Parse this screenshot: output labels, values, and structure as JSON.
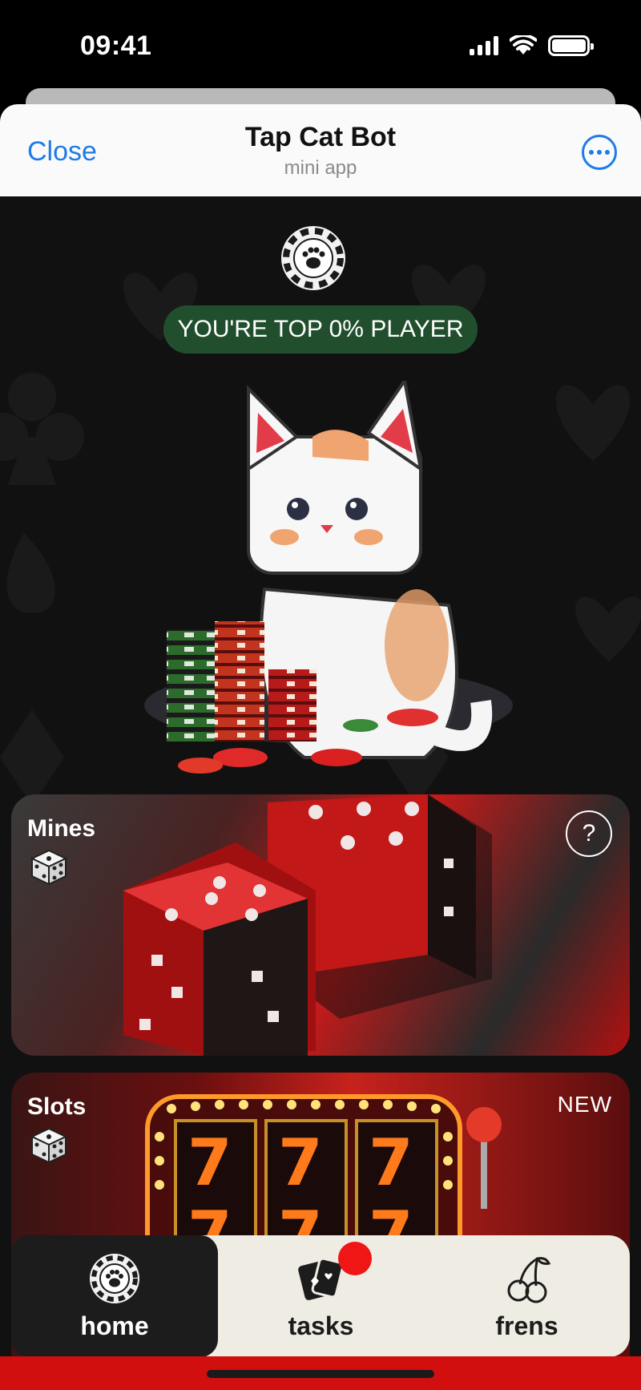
{
  "status_bar": {
    "time": "09:41",
    "icons": [
      "signal-icon",
      "wifi-icon",
      "battery-icon"
    ]
  },
  "header": {
    "close_label": "Close",
    "title": "Tap Cat Bot",
    "subtitle": "mini app",
    "more_icon": "more-options-icon"
  },
  "hero": {
    "logo_icon": "paw-chip-icon",
    "rank_badge": "YOU'RE TOP 0% PLAYER",
    "illustration": "pixel-cat-with-casino-chips"
  },
  "games": [
    {
      "title": "Mines",
      "icon": "dice-icon",
      "help_label": "?",
      "art": "red-pixel-dice"
    },
    {
      "title": "Slots",
      "icon": "dice-icon",
      "tag": "NEW",
      "art": "slot-machine-777"
    }
  ],
  "bottom_nav": {
    "items": [
      {
        "label": "home",
        "icon": "paw-chip-icon",
        "active": true
      },
      {
        "label": "tasks",
        "icon": "cards-icon",
        "active": false,
        "notification": true
      },
      {
        "label": "frens",
        "icon": "cherries-icon",
        "active": false
      }
    ]
  },
  "colors": {
    "accent_blue": "#1e7bea",
    "badge_green": "#214f2d",
    "casino_red": "#d10f0f",
    "nav_bg": "#efece3"
  }
}
